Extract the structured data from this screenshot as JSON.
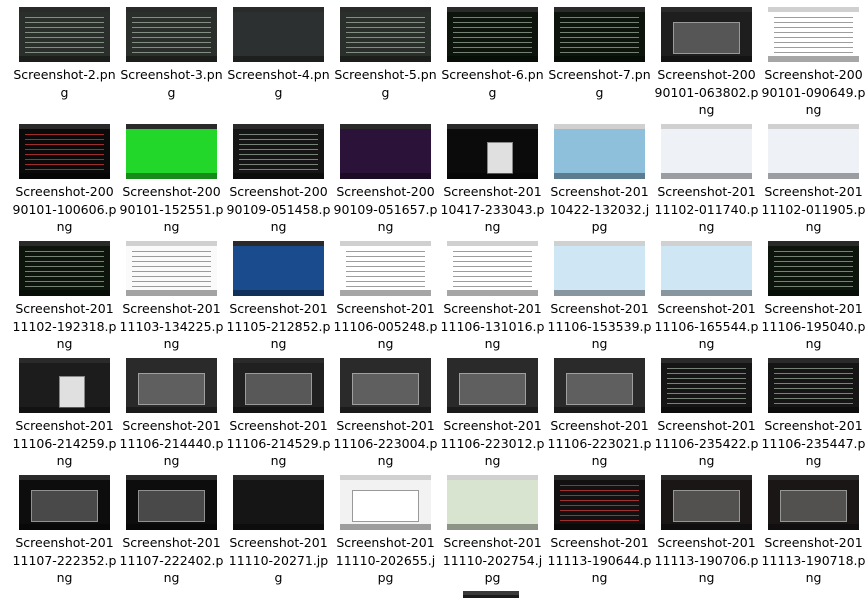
{
  "window": {
    "view": "large-icons"
  },
  "files": [
    {
      "label": "Screenshot-2.png",
      "theme": "dark-desktop"
    },
    {
      "label": "Screenshot-3.png",
      "theme": "dark-desktop"
    },
    {
      "label": "Screenshot-4.png",
      "theme": "dark-map"
    },
    {
      "label": "Screenshot-5.png",
      "theme": "dark-desktop"
    },
    {
      "label": "Screenshot-6.png",
      "theme": "dark-terminal"
    },
    {
      "label": "Screenshot-7.png",
      "theme": "dark-terminal"
    },
    {
      "label": "Screenshot-20090101-063802.png",
      "theme": "dialog-dark"
    },
    {
      "label": "Screenshot-20090101-090649.png",
      "theme": "white-text"
    },
    {
      "label": "Screenshot-20090101-100606.png",
      "theme": "dark-red-text"
    },
    {
      "label": "Screenshot-20090101-152551.png",
      "theme": "green"
    },
    {
      "label": "Screenshot-20090109-051458.png",
      "theme": "dark-list"
    },
    {
      "label": "Screenshot-20090109-051657.png",
      "theme": "purple"
    },
    {
      "label": "Screenshot-20110417-233043.png",
      "theme": "dark-card"
    },
    {
      "label": "Screenshot-20110422-132032.jpg",
      "theme": "clock-photo"
    },
    {
      "label": "Screenshot-20111102-011740.png",
      "theme": "white-web"
    },
    {
      "label": "Screenshot-20111102-011905.png",
      "theme": "white-web"
    },
    {
      "label": "Screenshot-20111102-192318.png",
      "theme": "dark-terminal"
    },
    {
      "label": "Screenshot-20111103-134225.png",
      "theme": "white-doc"
    },
    {
      "label": "Screenshot-20111105-212852.png",
      "theme": "blue-game"
    },
    {
      "label": "Screenshot-20111106-005248.png",
      "theme": "white-text"
    },
    {
      "label": "Screenshot-20111106-131016.png",
      "theme": "white-text"
    },
    {
      "label": "Screenshot-20111106-153539.png",
      "theme": "light-blue-chat"
    },
    {
      "label": "Screenshot-20111106-165544.png",
      "theme": "light-blue-chat"
    },
    {
      "label": "Screenshot-20111106-195040.png",
      "theme": "dark-terminal"
    },
    {
      "label": "Screenshot-20111106-214259.png",
      "theme": "dark-book"
    },
    {
      "label": "Screenshot-20111106-214440.png",
      "theme": "dark-form"
    },
    {
      "label": "Screenshot-20111106-214529.png",
      "theme": "dark-app"
    },
    {
      "label": "Screenshot-20111106-223004.png",
      "theme": "dark-form"
    },
    {
      "label": "Screenshot-20111106-223012.png",
      "theme": "dark-form"
    },
    {
      "label": "Screenshot-20111106-223021.png",
      "theme": "dark-form"
    },
    {
      "label": "Screenshot-20111106-235422.png",
      "theme": "dark-list"
    },
    {
      "label": "Screenshot-20111106-235447.png",
      "theme": "dark-list"
    },
    {
      "label": "Screenshot-20111107-222352.png",
      "theme": "dark-blue-side"
    },
    {
      "label": "Screenshot-20111107-222402.png",
      "theme": "dark-blue-side"
    },
    {
      "label": "Screenshot-20111110-20271.jpg",
      "theme": "dark-orange"
    },
    {
      "label": "Screenshot-20111110-202655.jpg",
      "theme": "white-form"
    },
    {
      "label": "Screenshot-20111110-202754.jpg",
      "theme": "keypad"
    },
    {
      "label": "Screenshot-20111113-190644.png",
      "theme": "dark-red-list"
    },
    {
      "label": "Screenshot-20111113-190706.png",
      "theme": "dark-red-form"
    },
    {
      "label": "Screenshot-20111113-190718.png",
      "theme": "dark-red-form"
    }
  ],
  "colors": {
    "dark-desktop": "#2b2f2b",
    "dark-map": "#2d3030",
    "dark-terminal": "#0c140c",
    "dialog-dark": "#1e1e1e",
    "white-text": "#ffffff",
    "dark-red-text": "#0a0a0a",
    "green": "#22d62a",
    "dark-list": "#151515",
    "purple": "#2a1238",
    "dark-card": "#0b0b0b",
    "clock-photo": "#8ec0dc",
    "white-web": "#eef2f6",
    "white-doc": "#fafafa",
    "blue-game": "#1a4b8c",
    "light-blue-chat": "#cfe7f5",
    "dark-book": "#1c1c1c",
    "dark-form": "#2a2a2a",
    "dark-app": "#202020",
    "dark-blue-side": "#0d0d0d",
    "dark-orange": "#151515",
    "white-form": "#f2f2f2",
    "keypad": "#d8e4cf",
    "dark-red-list": "#121010",
    "dark-red-form": "#1a1616"
  }
}
